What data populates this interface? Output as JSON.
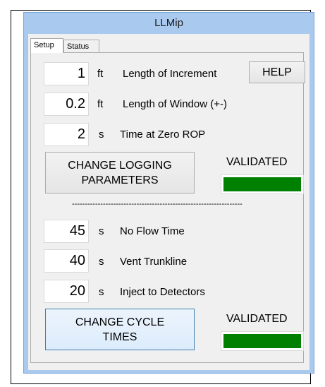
{
  "window": {
    "title": "LLMip"
  },
  "tabs": [
    {
      "label": "Setup",
      "active": true
    },
    {
      "label": "Status",
      "active": false
    }
  ],
  "logging": {
    "increment": {
      "value": "1",
      "unit": "ft",
      "label": "Length of Increment"
    },
    "window": {
      "value": "0.2",
      "unit": "ft",
      "label": "Length of Window (+-)"
    },
    "zero_rop": {
      "value": "2",
      "unit": "s",
      "label": "Time at Zero ROP"
    },
    "help_label": "HELP",
    "change_button_line1": "CHANGE LOGGING",
    "change_button_line2": "PARAMETERS",
    "validated_label": "VALIDATED",
    "validated_color": "#008000"
  },
  "separator": "------------------------------------------------------------------",
  "cycle": {
    "no_flow": {
      "value": "45",
      "unit": "s",
      "label": "No Flow Time"
    },
    "vent": {
      "value": "40",
      "unit": "s",
      "label": "Vent Trunkline"
    },
    "inject": {
      "value": "20",
      "unit": "s",
      "label": "Inject to Detectors"
    },
    "change_button_line1": "CHANGE CYCLE",
    "change_button_line2": "TIMES",
    "validated_label": "VALIDATED",
    "validated_color": "#008000"
  }
}
